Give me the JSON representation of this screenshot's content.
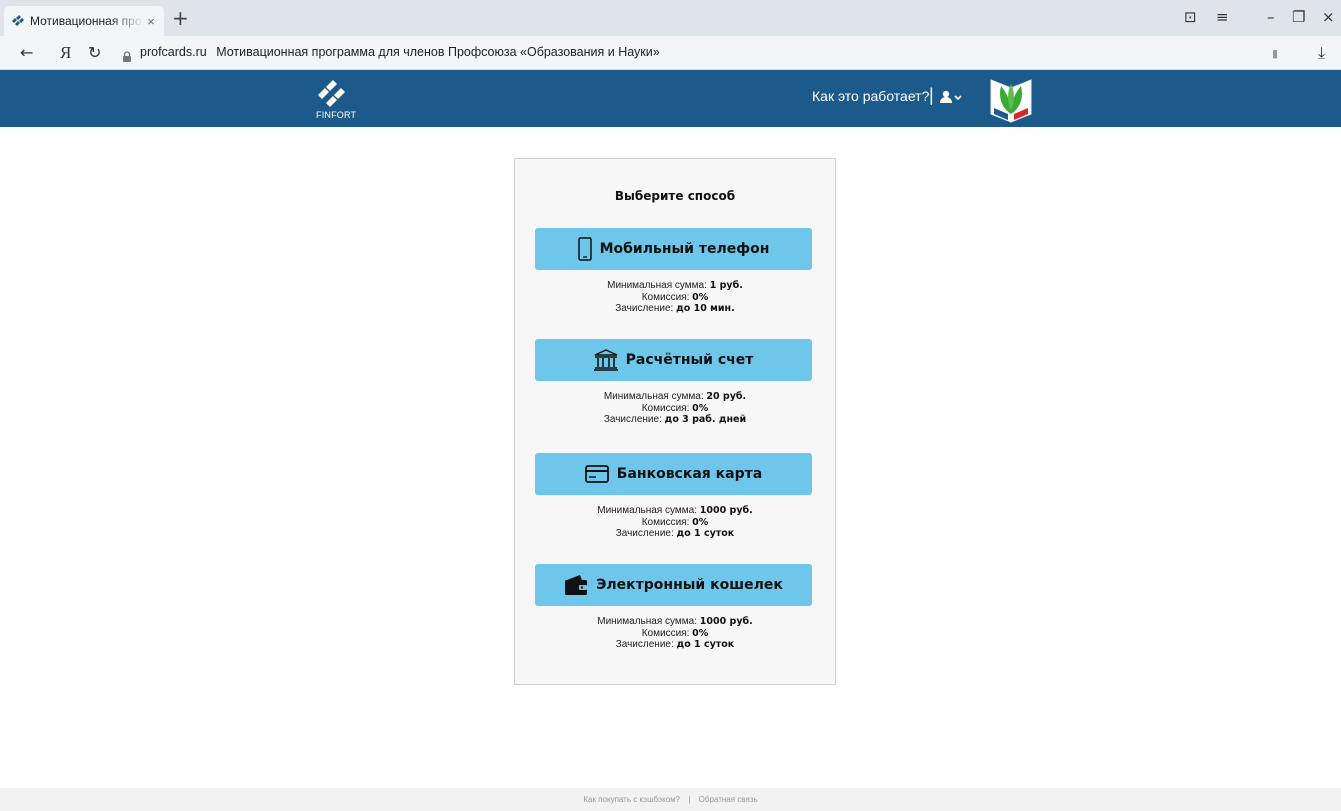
{
  "browser": {
    "tab_title": "Мотивационная программа для членов Профсоюза «Образования и Науки»",
    "tab_close": "×",
    "new_tab": "+",
    "back": "←",
    "yandex": "Я",
    "reload": "↻",
    "url_domain": "profcards.ru",
    "page_title": "Мотивационная программа для членов Профсоюза «Образования и Науки»",
    "bookmark": "▮",
    "download": "⤓",
    "win_minimize": "–",
    "win_restore": "❐",
    "win_close": "×",
    "win_menu": "≡",
    "win_pin": "⊡"
  },
  "header": {
    "logo_text": "FINFORT",
    "how_it_works": "Как это работает?",
    "separator": "|",
    "brand_color": "#1d5a8c"
  },
  "card": {
    "title": "Выберите способ",
    "methods": [
      {
        "icon": "mobile-phone-icon",
        "label": "Мобильный телефон",
        "min_label": "Минимальная сумма:",
        "min_value": "1 руб.",
        "fee_label": "Комиссия:",
        "fee_value": "0%",
        "time_label": "Зачисление:",
        "time_value": "до 10 мин."
      },
      {
        "icon": "bank-icon",
        "label": "Расчётный счет",
        "min_label": "Минимальная сумма:",
        "min_value": "20 руб.",
        "fee_label": "Комиссия:",
        "fee_value": "0%",
        "time_label": "Зачисление:",
        "time_value": "до 3 раб. дней"
      },
      {
        "icon": "credit-card-icon",
        "label": "Банковская карта",
        "min_label": "Минимальная сумма:",
        "min_value": "1000 руб.",
        "fee_label": "Комиссия:",
        "fee_value": "0%",
        "time_label": "Зачисление:",
        "time_value": "до 1 суток"
      },
      {
        "icon": "wallet-icon",
        "label": "Электронный кошелек",
        "min_label": "Минимальная сумма:",
        "min_value": "1000 руб.",
        "fee_label": "Комиссия:",
        "fee_value": "0%",
        "time_label": "Зачисление:",
        "time_value": "до 1 суток"
      }
    ],
    "button_color": "#6ec7ea"
  },
  "footer": {
    "link_cashback": "Как покупать с кэшбэком?",
    "separator": "|",
    "link_feedback": "Обратная связь"
  }
}
